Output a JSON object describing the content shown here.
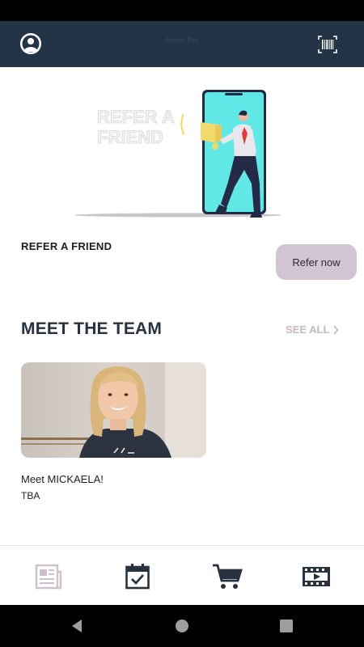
{
  "header": {
    "title": "Dream Bod",
    "avatar_icon": "user-avatar-icon",
    "barcode_icon": "barcode-icon"
  },
  "refer": {
    "illustration_text": [
      "REFER A",
      "FRIEND"
    ],
    "label": "REFER A FRIEND",
    "button_label": "Refer now"
  },
  "team": {
    "section_title": "MEET THE TEAM",
    "see_all_label": "SEE ALL",
    "members": [
      {
        "name": "Meet MICKAELA!",
        "role": "TBA"
      }
    ]
  },
  "tabs": [
    {
      "icon": "newspaper-icon",
      "active": true
    },
    {
      "icon": "calendar-check-icon",
      "active": false
    },
    {
      "icon": "cart-icon",
      "active": false
    },
    {
      "icon": "video-film-icon",
      "active": false
    }
  ],
  "colors": {
    "header_bg": "#243447",
    "accent": "#d2c4d0",
    "see_all": "#c8b5c6",
    "title": "#283140",
    "phone_screen": "#5fe8e6"
  }
}
